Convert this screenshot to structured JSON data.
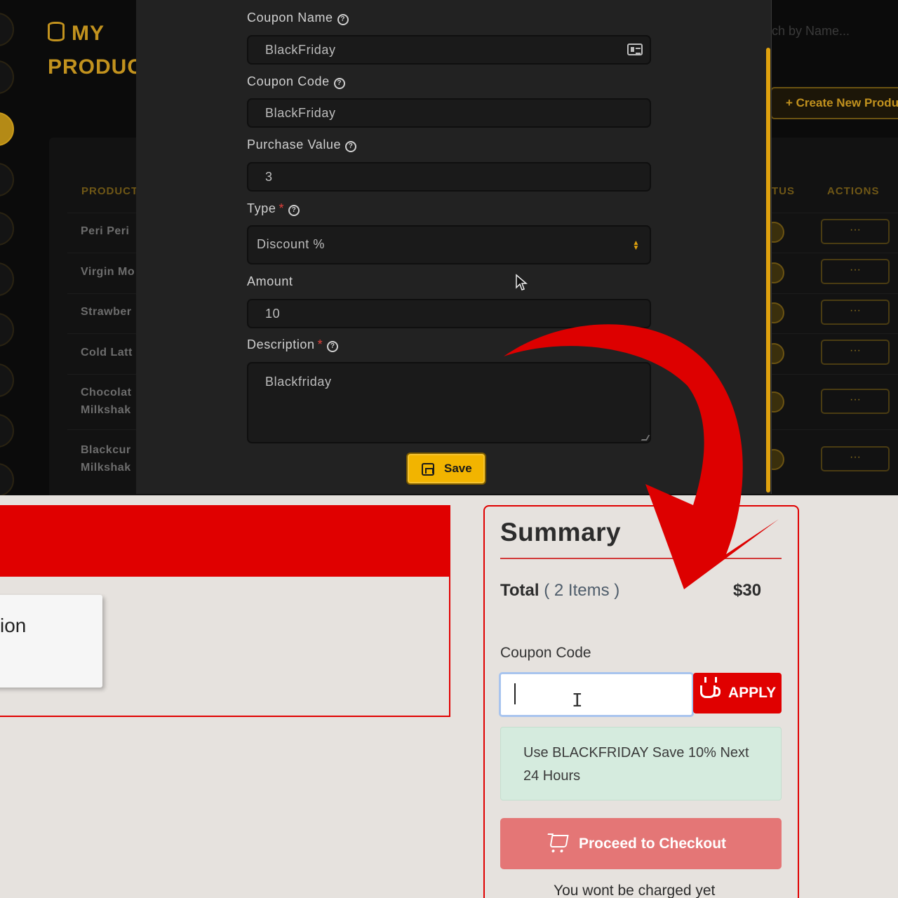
{
  "admin": {
    "brand_line1": "MY",
    "brand_line2": "PRODUC",
    "search_placeholder": "ch by Name...",
    "create_button": "+  Create New Produ",
    "table": {
      "headers": {
        "product": "PRODUCT",
        "status": "TUS",
        "actions": "ACTIONS"
      },
      "rows": [
        {
          "name": "Peri Peri"
        },
        {
          "name": "Virgin Mo"
        },
        {
          "name": "Strawber"
        },
        {
          "name": "Cold Latt"
        },
        {
          "name": "Chocolat\nMilkshak"
        },
        {
          "name": "Blackcur\nMilkshak"
        }
      ],
      "action_label": "···"
    },
    "modal": {
      "coupon_name_label": "Coupon Name",
      "coupon_name_value": "BlackFriday",
      "coupon_code_label": "Coupon Code",
      "coupon_code_value": "BlackFriday",
      "purchase_value_label": "Purchase Value",
      "purchase_value_value": "3",
      "type_label": "Type",
      "type_required": "*",
      "type_value": "Discount %",
      "amount_label": "Amount",
      "amount_value": "10",
      "description_label": "Description",
      "description_required": "*",
      "description_value": "Blackfriday",
      "save_button": "Save"
    }
  },
  "store": {
    "left_card_text": "ion",
    "summary": {
      "title": "Summary",
      "total_label": "Total",
      "total_items": "( 2 Items )",
      "total_amount": "$30",
      "coupon_label": "Coupon Code",
      "coupon_input_value": "",
      "apply_button": "APPLY",
      "promo_text": "Use BLACKFRIDAY Save 10% Next 24 Hours",
      "checkout_button": "Proceed to Checkout",
      "charged_note": "You wont be charged yet"
    }
  },
  "colors": {
    "admin_accent": "#c2921e",
    "save_button": "#f2b400",
    "store_red": "#e00000",
    "checkout_button": "#e47676",
    "promo_background": "#d5ebde",
    "annotation_arrow": "#dd0000"
  },
  "icons": [
    "database-icon",
    "help-icon",
    "id-card-icon",
    "sort-icon",
    "save-icon",
    "cursor-arrow-icon",
    "coffee-cup-icon",
    "cart-icon",
    "text-cursor-icon",
    "annotation-arrow"
  ]
}
